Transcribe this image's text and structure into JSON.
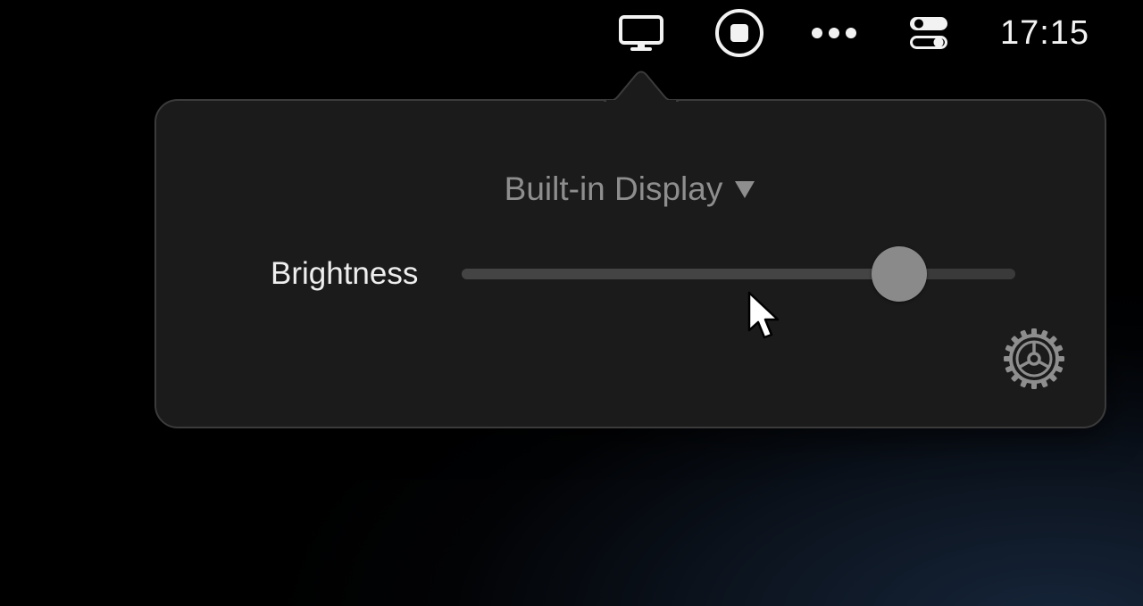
{
  "menubar": {
    "items": [
      {
        "icon": "display-icon"
      },
      {
        "icon": "stop-record-icon"
      },
      {
        "icon": "more-icon"
      },
      {
        "icon": "control-center-icon"
      }
    ],
    "clock": "17:15"
  },
  "popover": {
    "display_selector": {
      "label": "Built-in Display",
      "icon": "triangle-down-icon"
    },
    "brightness": {
      "label": "Brightness",
      "value": 0.79
    },
    "settings": {
      "icon": "gear-icon"
    }
  },
  "colors": {
    "panel_bg": "#1b1b1b",
    "panel_border": "#3b3b3b",
    "track": "#3a3a3a",
    "thumb": "#8a8a8a",
    "muted_text": "#8e8e8e"
  }
}
